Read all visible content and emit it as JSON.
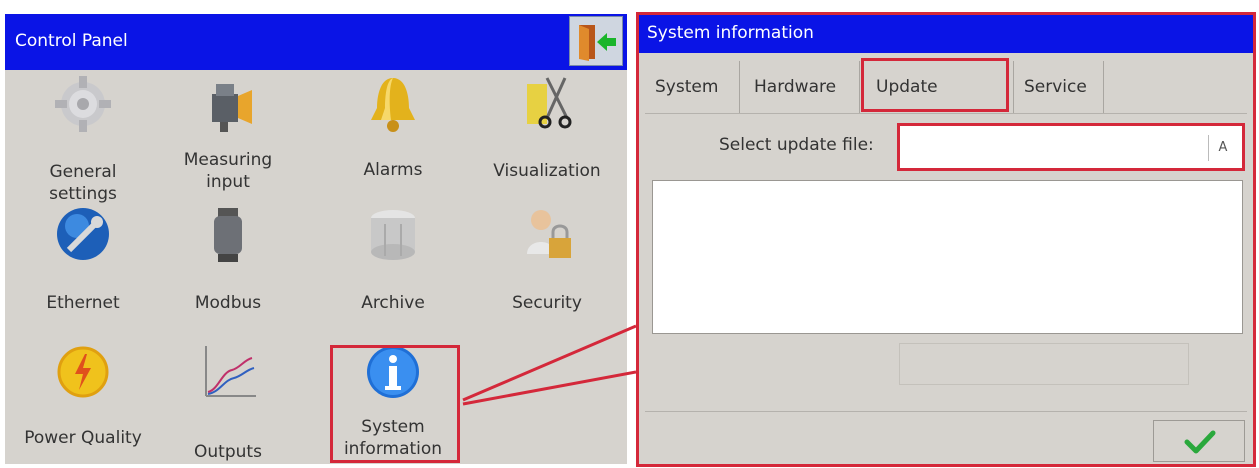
{
  "control_panel": {
    "title": "Control Panel",
    "items": [
      {
        "label": "General\nsettings",
        "icon": "gear-icon"
      },
      {
        "label": "Measuring\ninput",
        "icon": "sensor-icon"
      },
      {
        "label": "Alarms",
        "icon": "bell-icon"
      },
      {
        "label": "Visualization",
        "icon": "visualization-icon"
      },
      {
        "label": "Ethernet",
        "icon": "network-icon"
      },
      {
        "label": "Modbus",
        "icon": "modbus-icon"
      },
      {
        "label": "Archive",
        "icon": "archive-icon"
      },
      {
        "label": "Security",
        "icon": "security-icon"
      },
      {
        "label": "Power Quality",
        "icon": "power-quality-icon"
      },
      {
        "label": "Outputs",
        "icon": "outputs-icon"
      },
      {
        "label": "System\ninformation",
        "icon": "info-icon"
      }
    ],
    "exit_icon": "exit-door-icon"
  },
  "system_info": {
    "title": "System information",
    "tabs": [
      {
        "label": "System"
      },
      {
        "label": "Hardware"
      },
      {
        "label": "Update"
      },
      {
        "label": "Service"
      }
    ],
    "active_tab": "Update",
    "select_label": "Select update file:",
    "file_value": "",
    "keyboard_label": "A",
    "ok_icon": "checkmark-icon"
  },
  "colors": {
    "title_bar": "#0a14e6",
    "panel_bg": "#d6d3ce",
    "highlight": "#d4283a",
    "ok_green": "#2aa83c"
  }
}
